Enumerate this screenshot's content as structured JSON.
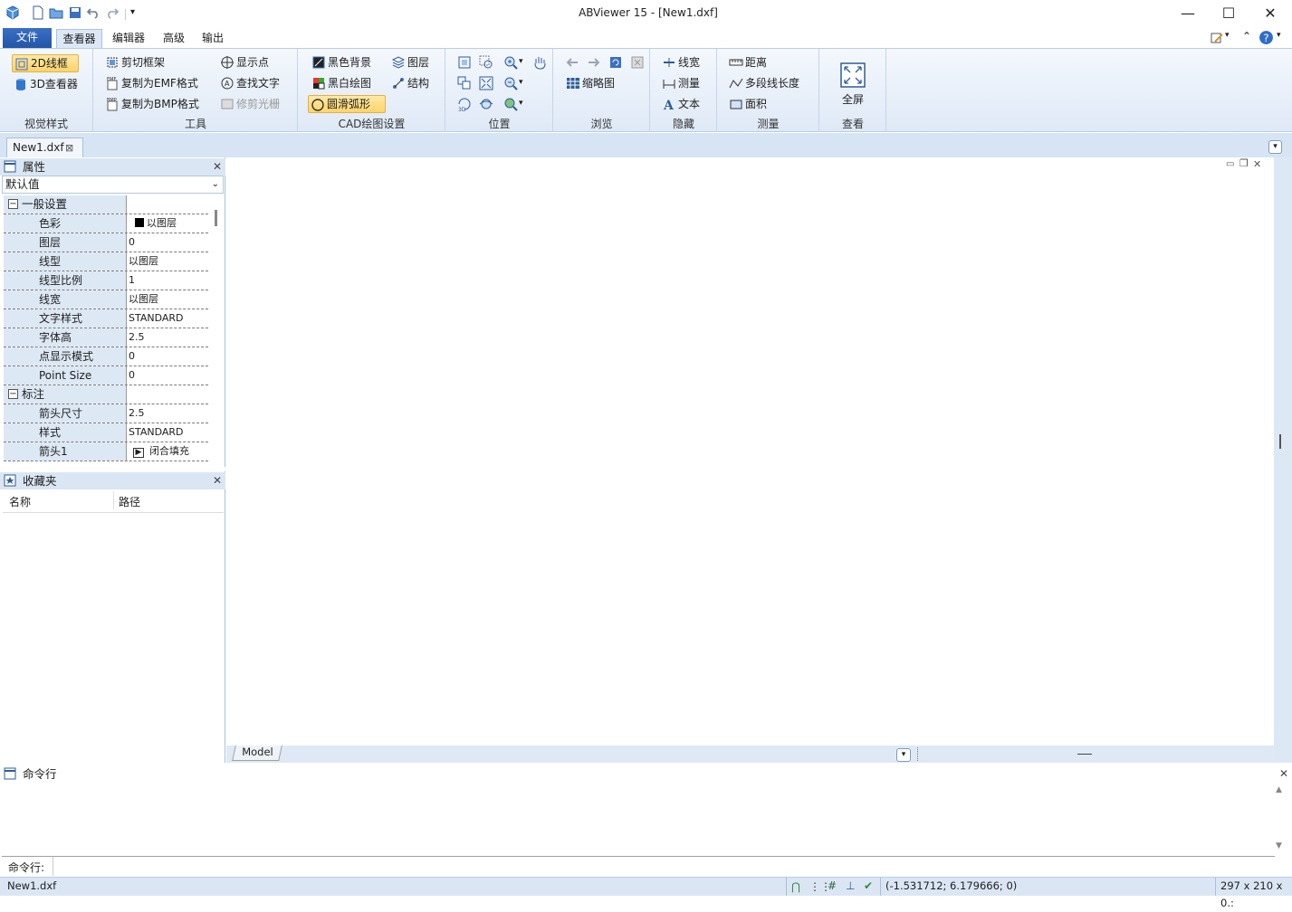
{
  "window": {
    "title": "ABViewer 15 - [New1.dxf]"
  },
  "tabs": {
    "file": "文件",
    "viewer": "查看器",
    "editor": "编辑器",
    "advanced": "高级",
    "output": "输出"
  },
  "ribbon": {
    "visual_style": {
      "label": "视觉样式",
      "items": [
        "2D线框",
        "3D查看器"
      ]
    },
    "tools": {
      "label": "工具",
      "items": [
        "剪切框架",
        "复制为EMF格式",
        "复制为BMP格式",
        "显示点",
        "查找文字",
        "修剪光栅"
      ]
    },
    "cad": {
      "label": "CAD绘图设置",
      "items": [
        "黑色背景",
        "黑白绘图",
        "圆滑弧形",
        "图层",
        "结构"
      ]
    },
    "position": {
      "label": "位置"
    },
    "browse": {
      "label": "浏览",
      "thumbnail": "缩略图"
    },
    "hide": {
      "label": "隐藏",
      "items": [
        "线宽",
        "测量",
        "文本"
      ]
    },
    "measure": {
      "label": "测量",
      "items": [
        "距离",
        "多段线长度",
        "面积"
      ]
    },
    "view": {
      "label": "查看",
      "fullscreen": "全屏"
    }
  },
  "doc_tab": "New1.dxf",
  "properties": {
    "title": "属性",
    "selector": "默认值",
    "rows": [
      {
        "k": "一般设置",
        "v": "",
        "cat": true
      },
      {
        "k": "色彩",
        "v": "以图层"
      },
      {
        "k": "图层",
        "v": "0"
      },
      {
        "k": "线型",
        "v": "以图层"
      },
      {
        "k": "线型比例",
        "v": "1"
      },
      {
        "k": "线宽",
        "v": "以图层"
      },
      {
        "k": "文字样式",
        "v": "STANDARD"
      },
      {
        "k": "字体高",
        "v": "2.5"
      },
      {
        "k": "点显示模式",
        "v": "0"
      },
      {
        "k": "Point Size",
        "v": "0"
      },
      {
        "k": "标注",
        "v": "",
        "cat": true
      },
      {
        "k": "箭头尺寸",
        "v": "2.5"
      },
      {
        "k": "样式",
        "v": "STANDARD"
      },
      {
        "k": "箭头1",
        "v": "闭合填充"
      }
    ]
  },
  "favorites": {
    "title": "收藏夹",
    "col_name": "名称",
    "col_path": "路径"
  },
  "model_tab": "Model",
  "command": {
    "title": "命令行",
    "prompt": "命令行:"
  },
  "status": {
    "file": "New1.dxf",
    "coords": "(-1.531712; 6.179666; 0)",
    "size": "297 x 210 x 0.:"
  },
  "colors": {
    "accent": "#2b579a",
    "ribbon_bg": "#dfe9f6",
    "pane_header": "#dbe6f4"
  }
}
